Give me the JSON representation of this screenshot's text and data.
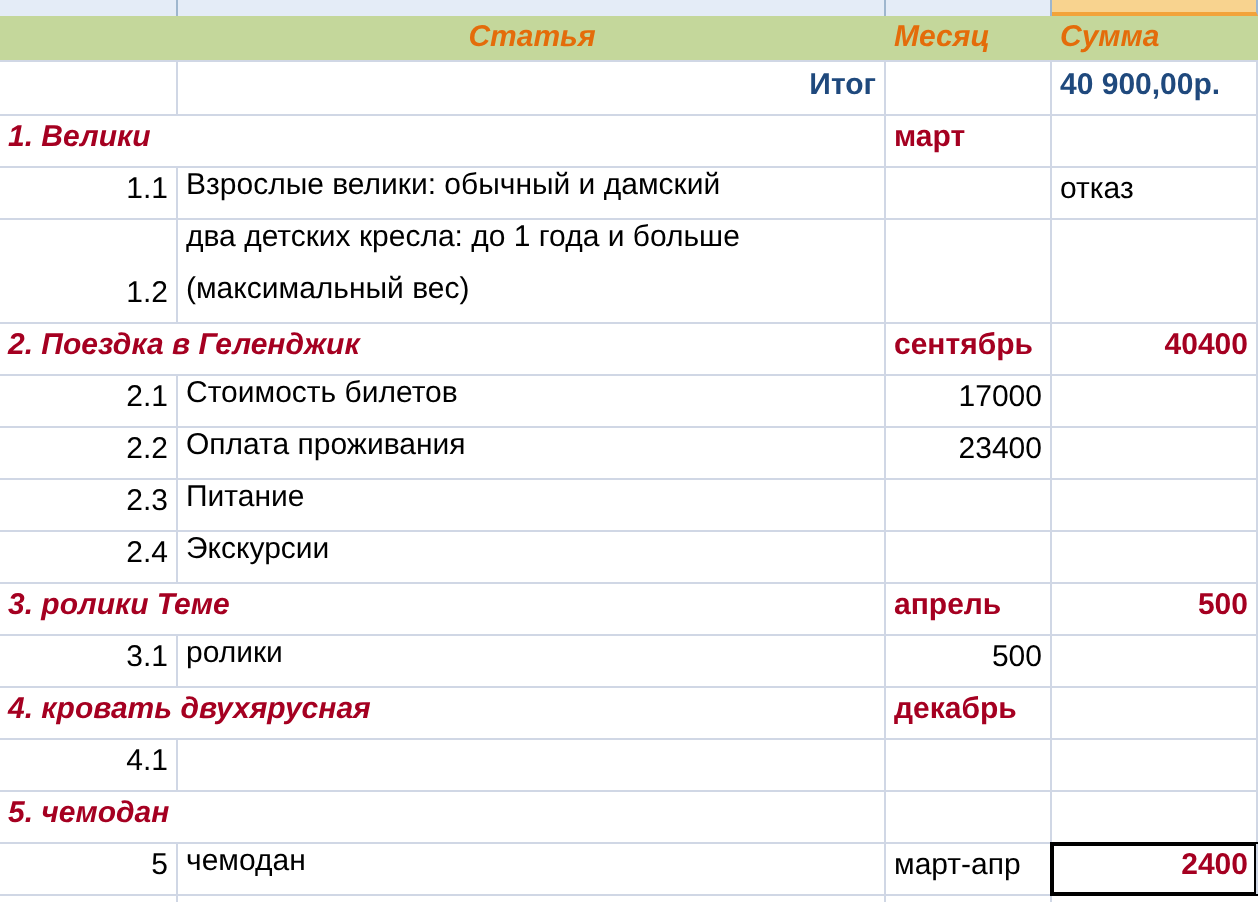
{
  "header": {
    "article": "Статья",
    "month": "Месяц",
    "sum": "Сумма"
  },
  "column_headers": [
    {
      "selected": false
    },
    {
      "selected": false
    },
    {
      "selected": false
    },
    {
      "selected": true
    }
  ],
  "total": {
    "label": "Итог",
    "sum": "40 900,00р."
  },
  "rows": [
    {
      "kind": "category",
      "label": "1. Велики",
      "month": "март",
      "sum": "",
      "selected": false
    },
    {
      "kind": "item",
      "num": "1.1",
      "text": "Взрослые велики: обычный и дамский",
      "month": "",
      "sum": "отказ",
      "selected": false
    },
    {
      "kind": "item",
      "num": "1.2",
      "text": "два детских кресла: до 1 года и больше (максимальный вес)",
      "month": "",
      "sum": "",
      "selected": false
    },
    {
      "kind": "category",
      "label": "2. Поездка в Геленджик",
      "month": "сентябрь",
      "sum": "40400",
      "selected": false
    },
    {
      "kind": "item",
      "num": "2.1",
      "text": "Стоимость билетов",
      "month": "17000",
      "sum": "",
      "selected": false
    },
    {
      "kind": "item",
      "num": "2.2",
      "text": "Оплата проживания",
      "month": "23400",
      "sum": "",
      "selected": false
    },
    {
      "kind": "item",
      "num": "2.3",
      "text": "Питание",
      "month": "",
      "sum": "",
      "selected": false
    },
    {
      "kind": "item",
      "num": "2.4",
      "text": "Экскурсии",
      "month": "",
      "sum": "",
      "selected": false
    },
    {
      "kind": "category",
      "label": "3. ролики Теме",
      "month": "апрель",
      "sum": "500",
      "selected": false
    },
    {
      "kind": "item",
      "num": "3.1",
      "text": "ролики",
      "month": "500",
      "sum": "",
      "selected": false
    },
    {
      "kind": "category",
      "label": "4. кровать двухярусная",
      "month": "декабрь",
      "sum": "",
      "selected": false
    },
    {
      "kind": "item",
      "num": "4.1",
      "text": "",
      "month": "",
      "sum": "",
      "selected": false
    },
    {
      "kind": "category",
      "label": "5. чемодан",
      "month": "",
      "sum": "",
      "selected": false
    },
    {
      "kind": "item",
      "num": "5",
      "text": "чемодан",
      "month": "март-апр",
      "sum": "2400",
      "selected": true
    }
  ]
}
